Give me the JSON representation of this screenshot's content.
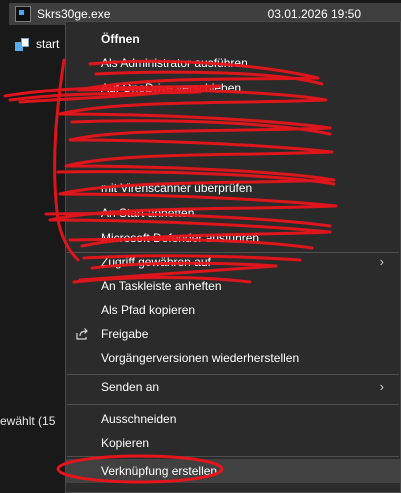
{
  "explorer": {
    "file_name": "Skrs30ge.exe",
    "file_date": "03.01.2026 19:50",
    "folder_name": "start",
    "status_text": "ewählt (15"
  },
  "context_menu": {
    "items": [
      {
        "label": "Öffnen"
      },
      {
        "label": "Als Administrator ausführen"
      },
      {
        "label": "Auf OneDrive verschieben"
      },
      {
        "label": ""
      },
      {
        "label": ""
      },
      {
        "label": ""
      },
      {
        "label": "mit Virenscanner überprüfen"
      },
      {
        "label": "An Start anheften"
      },
      {
        "label": "Microsoft Defender ausführen"
      },
      {
        "label": "Zugriff gewähren auf"
      },
      {
        "label": "An Taskleiste anheften"
      },
      {
        "label": "Als Pfad kopieren"
      },
      {
        "label": "Freigabe"
      },
      {
        "label": "Vorgängerversionen wiederherstellen"
      },
      {
        "label": "Senden an"
      },
      {
        "label": "Ausschneiden"
      },
      {
        "label": "Kopieren"
      },
      {
        "label": "Verknüpfung erstellen"
      }
    ],
    "submenu_chevron": "›",
    "scribble_color": "#e8141b"
  },
  "colors": {
    "menu_background": "#2b2b2b",
    "menu_border": "#4a4a4a",
    "highlight": "#414141",
    "selected_file_row": "#3f3f3f",
    "annotation_red": "#e8141b"
  }
}
